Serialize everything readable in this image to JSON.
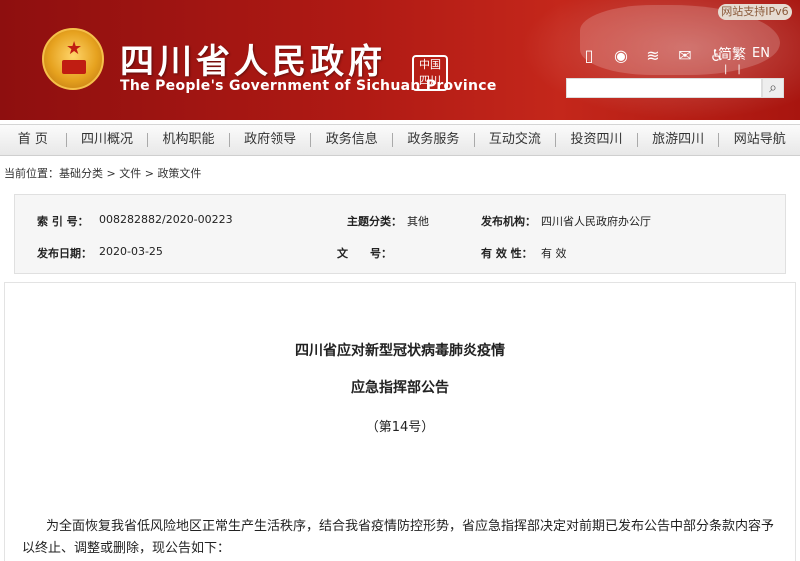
{
  "header": {
    "ipv6_label": "网站支持IPv6",
    "title_cn": "四川省人民政府",
    "title_en": "The People's Government of Sichuan Province",
    "seal_text": "中国四川",
    "icons": [
      "mobile-icon",
      "weibo-icon",
      "rss-icon",
      "email-icon",
      "accessibility-icon"
    ],
    "lang_cn": "简繁",
    "lang_en": "EN",
    "search_placeholder": ""
  },
  "nav": {
    "items": [
      "首 页",
      "四川概况",
      "机构职能",
      "政府领导",
      "政务信息",
      "政务服务",
      "互动交流",
      "投资四川",
      "旅游四川",
      "网站导航"
    ]
  },
  "breadcrumb": {
    "prefix": "当前位置：",
    "items": [
      "基础分类",
      "文件",
      "政策文件"
    ],
    "sep": " > "
  },
  "meta": {
    "index_label": "索 引 号：",
    "index_value": "008282882/2020-00223",
    "category_label": "主题分类：",
    "category_value": "其他",
    "issuer_label": "发布机构：",
    "issuer_value": "四川省人民政府办公厅",
    "date_label": "发布日期：",
    "date_value": "2020-03-25",
    "docno_label": "文　　号：",
    "docno_value": "",
    "validity_label": "有 效 性：",
    "validity_value": "有 效"
  },
  "document": {
    "title_line1": "四川省应对新型冠状病毒肺炎疫情",
    "title_line2": "应急指挥部公告",
    "number": "（第14号）",
    "paragraph": "为全面恢复我省低风险地区正常生产生活秩序，结合我省疫情防控形势，省应急指挥部决定对前期已发布公告中部分条款内容予以终止、调整或删除，现公告如下："
  },
  "colors": {
    "banner_red": "#b01a14",
    "nav_bg": "#eeeeee",
    "meta_bg": "#f6f6f6"
  }
}
